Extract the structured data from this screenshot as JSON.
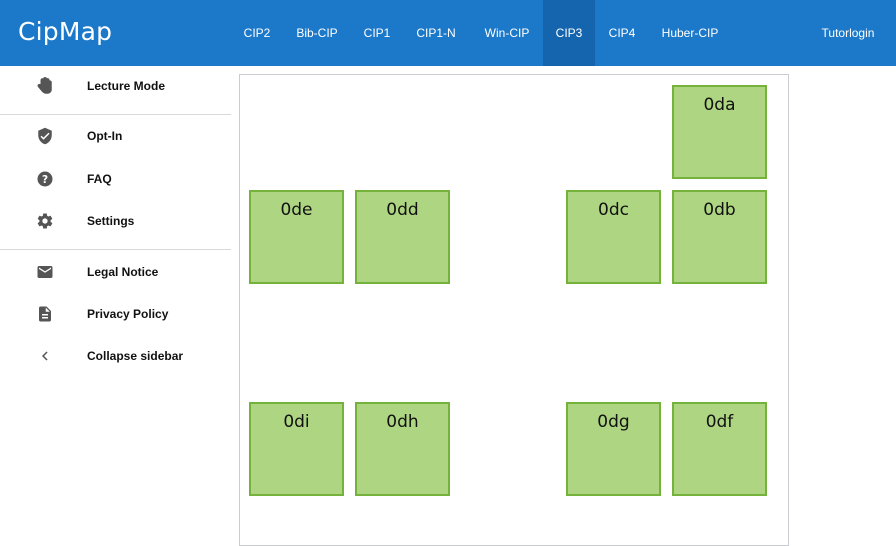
{
  "app": {
    "title": "CipMap"
  },
  "tabs": [
    {
      "label": "CIP2"
    },
    {
      "label": "Bib-CIP"
    },
    {
      "label": "CIP1"
    },
    {
      "label": "CIP1-N"
    },
    {
      "label": "Win-CIP"
    },
    {
      "label": "CIP3",
      "active": true
    },
    {
      "label": "CIP4"
    },
    {
      "label": "Huber-CIP"
    }
  ],
  "login": {
    "label": "Tutorlogin"
  },
  "sidebar": {
    "items": [
      {
        "label": "Lecture Mode",
        "icon": "hand-icon"
      },
      {
        "label": "Opt-In",
        "icon": "shield-check-icon"
      },
      {
        "label": "FAQ",
        "icon": "help-circle-icon"
      },
      {
        "label": "Settings",
        "icon": "gear-icon"
      },
      {
        "label": "Legal Notice",
        "icon": "mail-icon"
      },
      {
        "label": "Privacy Policy",
        "icon": "document-icon"
      },
      {
        "label": "Collapse sidebar",
        "icon": "chevron-left-icon"
      }
    ]
  },
  "rooms": [
    {
      "name": "0da"
    },
    {
      "name": "0de"
    },
    {
      "name": "0dd"
    },
    {
      "name": "0dc"
    },
    {
      "name": "0db"
    },
    {
      "name": "0di"
    },
    {
      "name": "0dh"
    },
    {
      "name": "0dg"
    },
    {
      "name": "0df"
    }
  ],
  "colors": {
    "topbar": "#1c78c9",
    "active_tab": "#1565ae",
    "room_fill": "#aed581",
    "room_border": "#74b23c"
  }
}
